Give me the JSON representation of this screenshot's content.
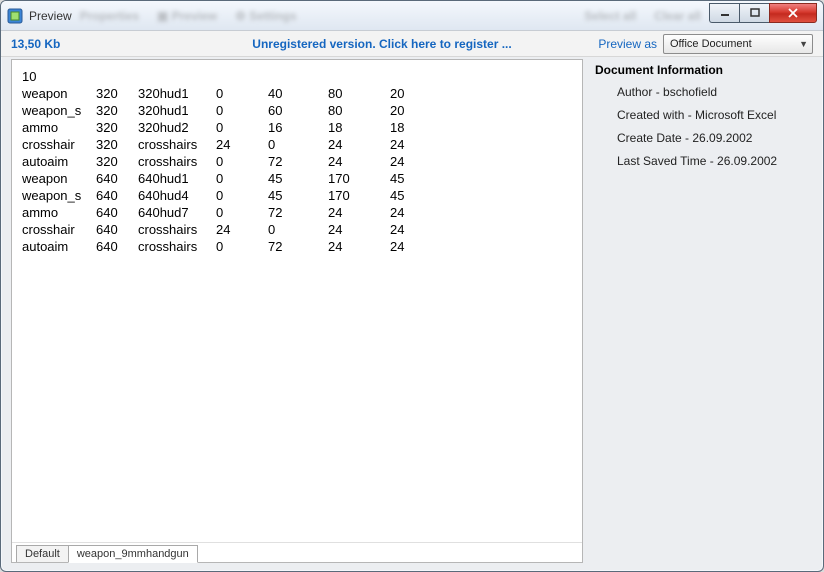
{
  "window": {
    "title": "Preview"
  },
  "header": {
    "filesize": "13,50 Kb",
    "unregistered": "Unregistered version. Click here to register ...",
    "preview_as_label": "Preview as",
    "preview_as_value": "Office Document"
  },
  "document": {
    "top_line": "10",
    "rows": [
      {
        "c0": "weapon",
        "c1": "320",
        "c2": "320hud1",
        "c3": "0",
        "c4": "40",
        "c5": "80",
        "c6": "20"
      },
      {
        "c0": "weapon_s",
        "c1": "320",
        "c2": "320hud1",
        "c3": "0",
        "c4": "60",
        "c5": "80",
        "c6": "20"
      },
      {
        "c0": "ammo",
        "c1": "320",
        "c2": "320hud2",
        "c3": "0",
        "c4": "16",
        "c5": "18",
        "c6": "18"
      },
      {
        "c0": "crosshair",
        "c1": "320",
        "c2": "crosshairs",
        "c3": "24",
        "c4": "0",
        "c5": "24",
        "c6": "24"
      },
      {
        "c0": "autoaim",
        "c1": "320",
        "c2": "crosshairs",
        "c3": "0",
        "c4": "72",
        "c5": "24",
        "c6": "24"
      },
      {
        "c0": "weapon",
        "c1": "640",
        "c2": "640hud1",
        "c3": "0",
        "c4": "45",
        "c5": "170",
        "c6": "45"
      },
      {
        "c0": "weapon_s",
        "c1": "640",
        "c2": "640hud4",
        "c3": "0",
        "c4": "45",
        "c5": "170",
        "c6": "45"
      },
      {
        "c0": "ammo",
        "c1": "640",
        "c2": "640hud7",
        "c3": "0",
        "c4": "72",
        "c5": "24",
        "c6": "24"
      },
      {
        "c0": "crosshair",
        "c1": "640",
        "c2": "crosshairs",
        "c3": "24",
        "c4": "0",
        "c5": "24",
        "c6": "24"
      },
      {
        "c0": "autoaim",
        "c1": "640",
        "c2": "crosshairs",
        "c3": "0",
        "c4": "72",
        "c5": "24",
        "c6": "24"
      }
    ]
  },
  "tabs": {
    "items": [
      {
        "label": "Default"
      },
      {
        "label": "weapon_9mmhandgun"
      }
    ]
  },
  "info": {
    "heading": "Document Information",
    "items": [
      "Author - bschofield",
      "Created with - Microsoft Excel",
      "Create Date - 26.09.2002",
      "Last Saved Time - 26.09.2002"
    ]
  }
}
